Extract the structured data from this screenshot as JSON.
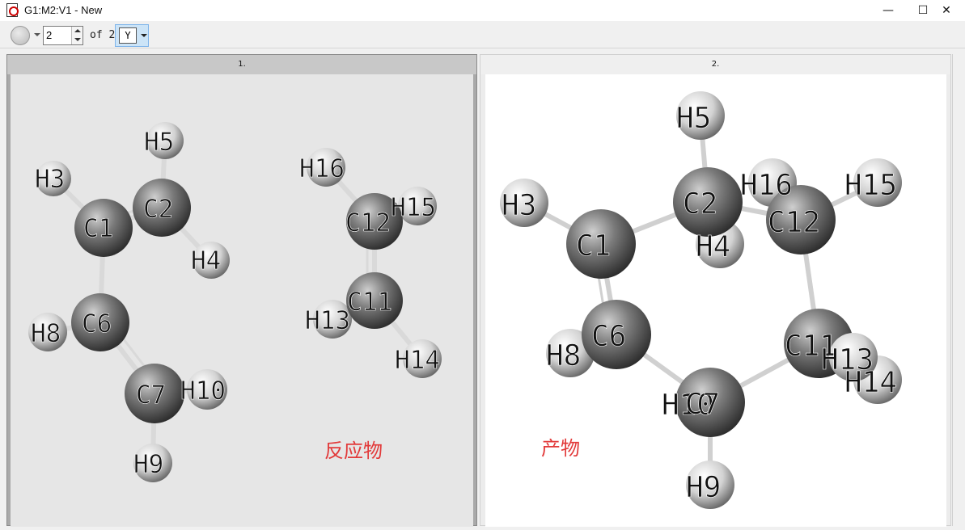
{
  "window": {
    "title": "G1:M2:V1 - New",
    "minimize": "—",
    "maximize": "☐",
    "close": "✕"
  },
  "toolbar": {
    "spin_value": "2",
    "of_label": "of 2",
    "tool_glyph": "Y"
  },
  "panels": [
    {
      "header": "1.",
      "caption": "反应物",
      "atoms": [
        "C1",
        "C2",
        "H3",
        "H4",
        "H5",
        "C6",
        "C7",
        "H8",
        "H9",
        "H10",
        "C11",
        "C12",
        "H13",
        "H14",
        "H15",
        "H16"
      ]
    },
    {
      "header": "2.",
      "caption": "产物",
      "atoms": [
        "C1",
        "C2",
        "H3",
        "H4",
        "H5",
        "C6",
        "C7",
        "H8",
        "H9",
        "H10",
        "C11",
        "C12",
        "H13",
        "H14",
        "H15",
        "H16"
      ]
    }
  ],
  "icons": {
    "app": "document-app-icon",
    "tool": "selector-tool-icon"
  }
}
